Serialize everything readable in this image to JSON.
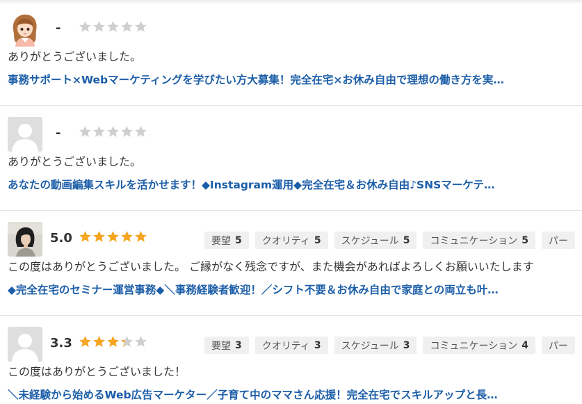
{
  "reviews": [
    {
      "avatar": "girl-illustration-avatar",
      "score": "-",
      "rating": 0,
      "criteria": [],
      "comment": "ありがとうございました。",
      "job_title": "事務サポート×Webマーケティングを学びたい方大募集！完全在宅×お休み自由で理想の働き方を実…"
    },
    {
      "avatar": "default-user-avatar",
      "score": "-",
      "rating": 0,
      "criteria": [],
      "comment": "ありがとうございました。",
      "job_title": "あなたの動画編集スキルを活かせます！◆Instagram運用◆完全在宅＆お休み自由♪SNSマーケテ…"
    },
    {
      "avatar": "woman-photo-avatar",
      "score": "5.0",
      "rating": 5,
      "criteria": [
        {
          "label": "要望",
          "score": "5"
        },
        {
          "label": "クオリティ",
          "score": "5"
        },
        {
          "label": "スケジュール",
          "score": "5"
        },
        {
          "label": "コミュニケーション",
          "score": "5"
        },
        {
          "label": "パー",
          "score": ""
        }
      ],
      "comment": "この度はありがとうございました。 ご縁がなく残念ですが、また機会があればよろしくお願いいたします",
      "job_title": "◆完全在宅のセミナー運営事務◆＼事務経験者歓迎！／シフト不要＆お休み自由で家庭との両立も叶…"
    },
    {
      "avatar": "default-user-avatar",
      "score": "3.3",
      "rating": 3.3,
      "criteria": [
        {
          "label": "要望",
          "score": "3"
        },
        {
          "label": "クオリティ",
          "score": "3"
        },
        {
          "label": "スケジュール",
          "score": "3"
        },
        {
          "label": "コミュニケーション",
          "score": "4"
        },
        {
          "label": "パー",
          "score": ""
        }
      ],
      "comment": "この度はありがとうございました！",
      "job_title": "＼未経験から始めるWeb広告マーケター／子育て中のママさん応援！完全在宅でスキルアップと長…"
    }
  ],
  "colors": {
    "star_filled": "#f5a623",
    "star_empty": "#cfcfcf",
    "link": "#1c5ea8",
    "chip_bg": "#f0f0f0"
  }
}
